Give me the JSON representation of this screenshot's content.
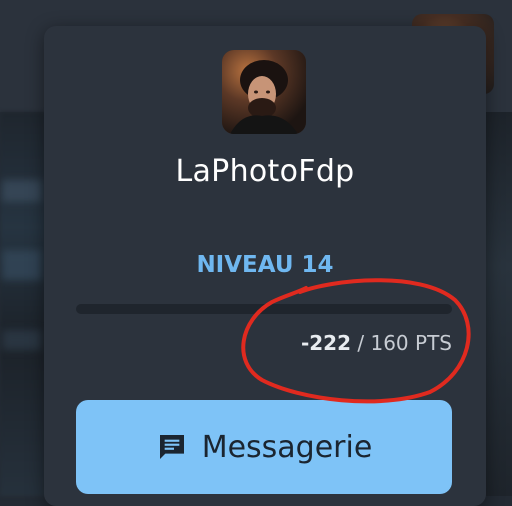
{
  "profile": {
    "username": "LaPhotoFdp",
    "level_label": "NIVEAU 14",
    "points_current": "-222",
    "points_separator": " / ",
    "points_total": "160 PTS",
    "progress_fraction": 0
  },
  "actions": {
    "messagerie_label": "Messagerie",
    "messagerie_icon": "chat-icon"
  },
  "colors": {
    "accent": "#6fb7f0",
    "button_bg": "#7ec3f7",
    "card_bg": "#2c333d",
    "annotation": "#e02a1f"
  }
}
